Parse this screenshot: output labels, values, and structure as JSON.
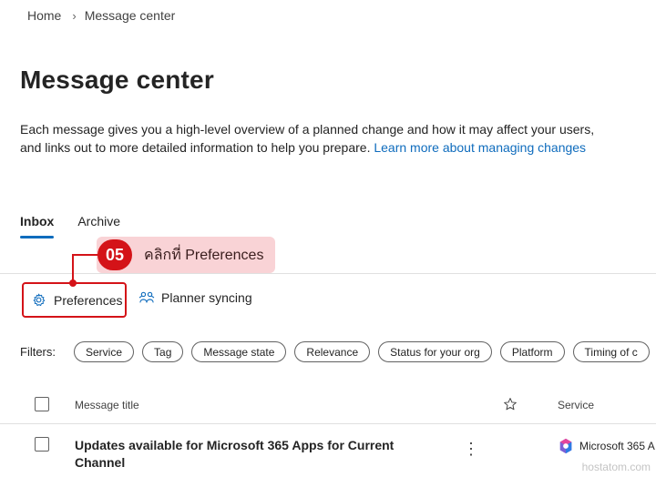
{
  "breadcrumb": {
    "home": "Home",
    "separator": "›",
    "current": "Message center"
  },
  "page": {
    "title": "Message center",
    "description": "Each message gives you a high-level overview of a planned change and how it may affect your users, and links out to more detailed information to help you prepare.",
    "learn_more_link": "Learn more about managing changes"
  },
  "tabs": [
    {
      "label": "Inbox",
      "active": true
    },
    {
      "label": "Archive",
      "active": false
    }
  ],
  "callout": {
    "number": "05",
    "text": "คลิกที่ Preferences",
    "color": "#d41318",
    "background": "#f9d3d6"
  },
  "toolbar": {
    "preferences_label": "Preferences",
    "preferences_icon": "gear-icon",
    "planner_label": "Planner syncing",
    "planner_icon": "planner-people-icon"
  },
  "filters": {
    "label": "Filters:",
    "chips": [
      "Service",
      "Tag",
      "Message state",
      "Relevance",
      "Status for your org",
      "Platform",
      "Timing of c"
    ]
  },
  "table": {
    "columns": {
      "title": "Message title",
      "star_icon": "star-icon",
      "service": "Service"
    },
    "rows": [
      {
        "title": "Updates available for Microsoft 365 Apps for Current Channel",
        "service": "Microsoft 365 A",
        "service_icon": "microsoft-365-icon"
      }
    ]
  },
  "watermark": "hostatom.com",
  "colors": {
    "accent": "#0f6cbd",
    "highlight": "#d41318"
  }
}
